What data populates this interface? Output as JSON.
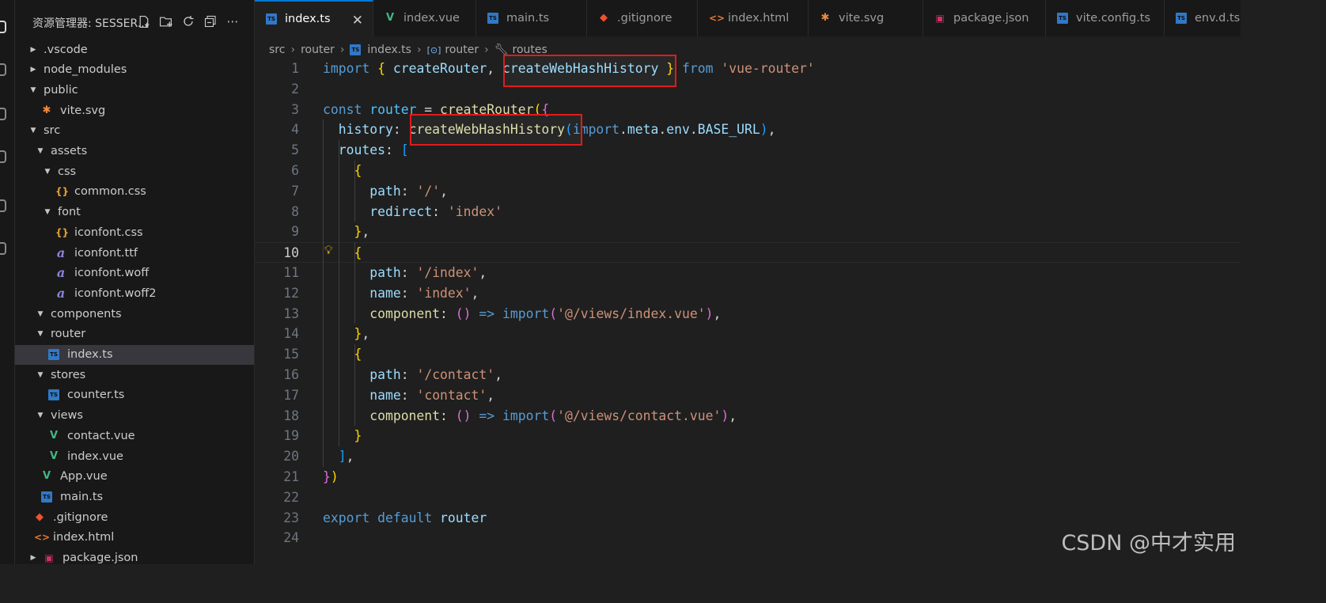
{
  "explorer": {
    "title": "资源管理器: SESSER...",
    "tools": [
      "new-file-icon",
      "new-folder-icon",
      "refresh-icon",
      "collapse-all-icon",
      "more-icon"
    ],
    "items": [
      {
        "label": ".vscode",
        "kind": "folder",
        "expanded": false,
        "depth": 0
      },
      {
        "label": "node_modules",
        "kind": "folder",
        "expanded": false,
        "depth": 0
      },
      {
        "label": "public",
        "kind": "folder",
        "expanded": true,
        "depth": 0
      },
      {
        "label": "vite.svg",
        "kind": "vite",
        "depth": 1
      },
      {
        "label": "src",
        "kind": "folder",
        "expanded": true,
        "depth": 0
      },
      {
        "label": "assets",
        "kind": "folder",
        "expanded": true,
        "depth": 1
      },
      {
        "label": "css",
        "kind": "folder",
        "expanded": true,
        "depth": 2
      },
      {
        "label": "common.css",
        "kind": "css",
        "depth": 3
      },
      {
        "label": "font",
        "kind": "folder",
        "expanded": true,
        "depth": 2
      },
      {
        "label": "iconfont.css",
        "kind": "css",
        "depth": 3
      },
      {
        "label": "iconfont.ttf",
        "kind": "font",
        "depth": 3
      },
      {
        "label": "iconfont.woff",
        "kind": "font",
        "depth": 3
      },
      {
        "label": "iconfont.woff2",
        "kind": "font",
        "depth": 3
      },
      {
        "label": "components",
        "kind": "folder",
        "expanded": true,
        "depth": 1
      },
      {
        "label": "router",
        "kind": "folder",
        "expanded": true,
        "depth": 1
      },
      {
        "label": "index.ts",
        "kind": "ts",
        "depth": 2,
        "selected": true
      },
      {
        "label": "stores",
        "kind": "folder",
        "expanded": true,
        "depth": 1
      },
      {
        "label": "counter.ts",
        "kind": "ts",
        "depth": 2
      },
      {
        "label": "views",
        "kind": "folder",
        "expanded": true,
        "depth": 1
      },
      {
        "label": "contact.vue",
        "kind": "vue",
        "depth": 2
      },
      {
        "label": "index.vue",
        "kind": "vue",
        "depth": 2
      },
      {
        "label": "App.vue",
        "kind": "vue",
        "depth": 1
      },
      {
        "label": "main.ts",
        "kind": "ts",
        "depth": 1
      },
      {
        "label": ".gitignore",
        "kind": "git",
        "depth": 0
      },
      {
        "label": "index.html",
        "kind": "html",
        "depth": 0
      },
      {
        "label": "package.json",
        "kind": "json",
        "expanded": false,
        "depth": 0
      }
    ]
  },
  "tabs": [
    {
      "label": "index.ts",
      "kind": "ts",
      "active": true
    },
    {
      "label": "index.vue",
      "kind": "vue"
    },
    {
      "label": "main.ts",
      "kind": "ts"
    },
    {
      "label": ".gitignore",
      "kind": "git"
    },
    {
      "label": "index.html",
      "kind": "html"
    },
    {
      "label": "vite.svg",
      "kind": "vite"
    },
    {
      "label": "package.json",
      "kind": "json"
    },
    {
      "label": "vite.config.ts",
      "kind": "ts"
    },
    {
      "label": "env.d.ts",
      "kind": "ts"
    }
  ],
  "tab_close": "✕",
  "breadcrumb": {
    "part1": "src",
    "part2": "router",
    "part3": "index.ts",
    "part4": "router",
    "part5": "routes"
  },
  "editor": {
    "current_line": 10,
    "lines": [
      [
        [
          "kw",
          "import"
        ],
        [
          "pl",
          " "
        ],
        [
          "b1",
          "{"
        ],
        [
          "pl",
          " "
        ],
        [
          "var",
          "createRouter"
        ],
        [
          "pl",
          ", "
        ],
        [
          "var",
          "createWebHashHistory"
        ],
        [
          "pl",
          " "
        ],
        [
          "b1",
          "}"
        ],
        [
          "pl",
          " "
        ],
        [
          "kw",
          "from"
        ],
        [
          "pl",
          " "
        ],
        [
          "str",
          "'vue-router'"
        ]
      ],
      [],
      [
        [
          "kw",
          "const"
        ],
        [
          "pl",
          " "
        ],
        [
          "cst",
          "router"
        ],
        [
          "pl",
          " = "
        ],
        [
          "fn",
          "createRouter"
        ],
        [
          "b1",
          "("
        ],
        [
          "b2",
          "{"
        ]
      ],
      [
        [
          "pl",
          "  "
        ],
        [
          "var",
          "history"
        ],
        [
          "pl",
          ": "
        ],
        [
          "fn",
          "createWebHashHistory"
        ],
        [
          "b3",
          "("
        ],
        [
          "kw",
          "import"
        ],
        [
          "pl",
          "."
        ],
        [
          "var",
          "meta"
        ],
        [
          "pl",
          "."
        ],
        [
          "var",
          "env"
        ],
        [
          "pl",
          "."
        ],
        [
          "var",
          "BASE_URL"
        ],
        [
          "b3",
          ")"
        ],
        [
          "pl",
          ","
        ]
      ],
      [
        [
          "pl",
          "  "
        ],
        [
          "var",
          "routes"
        ],
        [
          "pl",
          ": "
        ],
        [
          "b3",
          "["
        ]
      ],
      [
        [
          "pl",
          "    "
        ],
        [
          "b1",
          "{"
        ]
      ],
      [
        [
          "pl",
          "      "
        ],
        [
          "var",
          "path"
        ],
        [
          "pl",
          ": "
        ],
        [
          "str",
          "'/'"
        ],
        [
          "pl",
          ","
        ]
      ],
      [
        [
          "pl",
          "      "
        ],
        [
          "var",
          "redirect"
        ],
        [
          "pl",
          ": "
        ],
        [
          "str",
          "'index'"
        ]
      ],
      [
        [
          "pl",
          "    "
        ],
        [
          "b1",
          "}"
        ],
        [
          "pl",
          ","
        ]
      ],
      [
        [
          "pl",
          "    "
        ],
        [
          "b1",
          "{"
        ]
      ],
      [
        [
          "pl",
          "      "
        ],
        [
          "var",
          "path"
        ],
        [
          "pl",
          ": "
        ],
        [
          "str",
          "'/index'"
        ],
        [
          "pl",
          ","
        ]
      ],
      [
        [
          "pl",
          "      "
        ],
        [
          "var",
          "name"
        ],
        [
          "pl",
          ": "
        ],
        [
          "str",
          "'index'"
        ],
        [
          "pl",
          ","
        ]
      ],
      [
        [
          "pl",
          "      "
        ],
        [
          "fn",
          "component"
        ],
        [
          "pl",
          ": "
        ],
        [
          "b2",
          "()"
        ],
        [
          "pl",
          " "
        ],
        [
          "kw",
          "=>"
        ],
        [
          "pl",
          " "
        ],
        [
          "kw",
          "import"
        ],
        [
          "b2",
          "("
        ],
        [
          "str",
          "'@/views/index.vue'"
        ],
        [
          "b2",
          ")"
        ],
        [
          "pl",
          ","
        ]
      ],
      [
        [
          "pl",
          "    "
        ],
        [
          "b1",
          "}"
        ],
        [
          "pl",
          ","
        ]
      ],
      [
        [
          "pl",
          "    "
        ],
        [
          "b1",
          "{"
        ]
      ],
      [
        [
          "pl",
          "      "
        ],
        [
          "var",
          "path"
        ],
        [
          "pl",
          ": "
        ],
        [
          "str",
          "'/contact'"
        ],
        [
          "pl",
          ","
        ]
      ],
      [
        [
          "pl",
          "      "
        ],
        [
          "var",
          "name"
        ],
        [
          "pl",
          ": "
        ],
        [
          "str",
          "'contact'"
        ],
        [
          "pl",
          ","
        ]
      ],
      [
        [
          "pl",
          "      "
        ],
        [
          "fn",
          "component"
        ],
        [
          "pl",
          ": "
        ],
        [
          "b2",
          "()"
        ],
        [
          "pl",
          " "
        ],
        [
          "kw",
          "=>"
        ],
        [
          "pl",
          " "
        ],
        [
          "kw",
          "import"
        ],
        [
          "b2",
          "("
        ],
        [
          "str",
          "'@/views/contact.vue'"
        ],
        [
          "b2",
          ")"
        ],
        [
          "pl",
          ","
        ]
      ],
      [
        [
          "pl",
          "    "
        ],
        [
          "b1",
          "}"
        ]
      ],
      [
        [
          "pl",
          "  "
        ],
        [
          "b3",
          "]"
        ],
        [
          "pl",
          ","
        ]
      ],
      [
        [
          "b2",
          "}"
        ],
        [
          "b1",
          ")"
        ]
      ],
      [],
      [
        [
          "kw",
          "export"
        ],
        [
          "pl",
          " "
        ],
        [
          "kw",
          "default"
        ],
        [
          "pl",
          " "
        ],
        [
          "var",
          "router"
        ]
      ],
      []
    ]
  },
  "watermark": "CSDN @中才实用",
  "colors": {
    "highlight_box": "#e11b1b",
    "accent": "#0078d4"
  }
}
